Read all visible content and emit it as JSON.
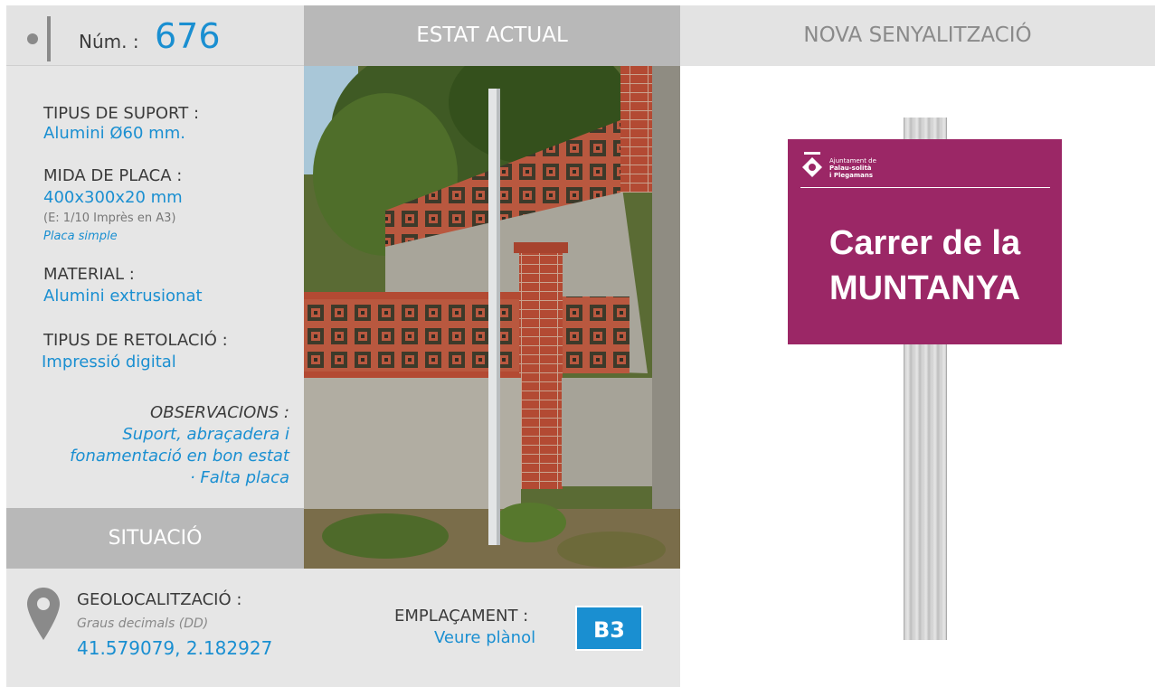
{
  "header": {
    "num_label": "Núm. :",
    "num_value": "676",
    "photo_title": "ESTAT ACTUAL",
    "new_title": "NOVA SENYALITZACIÓ"
  },
  "support": {
    "tipus_label": "TIPUS DE SUPORT :",
    "tipus_value": "Alumini Ø60 mm.",
    "mida_label": "MIDA DE PLACA :",
    "mida_value": "400x300x20 mm",
    "mida_scale": "(E: 1/10 Imprès en A3)",
    "mida_type": "Placa simple",
    "material_label": "MATERIAL :",
    "material_value": "Alumini extrusionat",
    "retolacio_label": "TIPUS DE RETOLACIÓ :",
    "retolacio_value": "Impressió digital",
    "obs_label": "OBSERVACIONS :",
    "obs_lines": [
      "Suport, abraçadera i",
      "fonamentació en bon estat",
      "· Falta placa"
    ]
  },
  "situacio": {
    "title": "SITUACIÓ",
    "geo_label": "GEOLOCALITZACIÓ :",
    "geo_sub": "Graus decimals (DD)",
    "geo_value": "41.579079, 2.182927",
    "empl_label": "EMPLAÇAMENT :",
    "empl_value": "Veure plànol",
    "empl_badge": "B3"
  },
  "sign": {
    "logo_line1": "Ajuntament de",
    "logo_line2": "Palau-solità",
    "logo_line3": "i Plegamans",
    "line1": "Carrer de la",
    "line2": "MUNTANYA",
    "color": "#9b2766"
  },
  "colors": {
    "accent": "#1a8fd1",
    "header_gray": "#b8b8b8",
    "panel_gray": "#e6e6e6"
  }
}
